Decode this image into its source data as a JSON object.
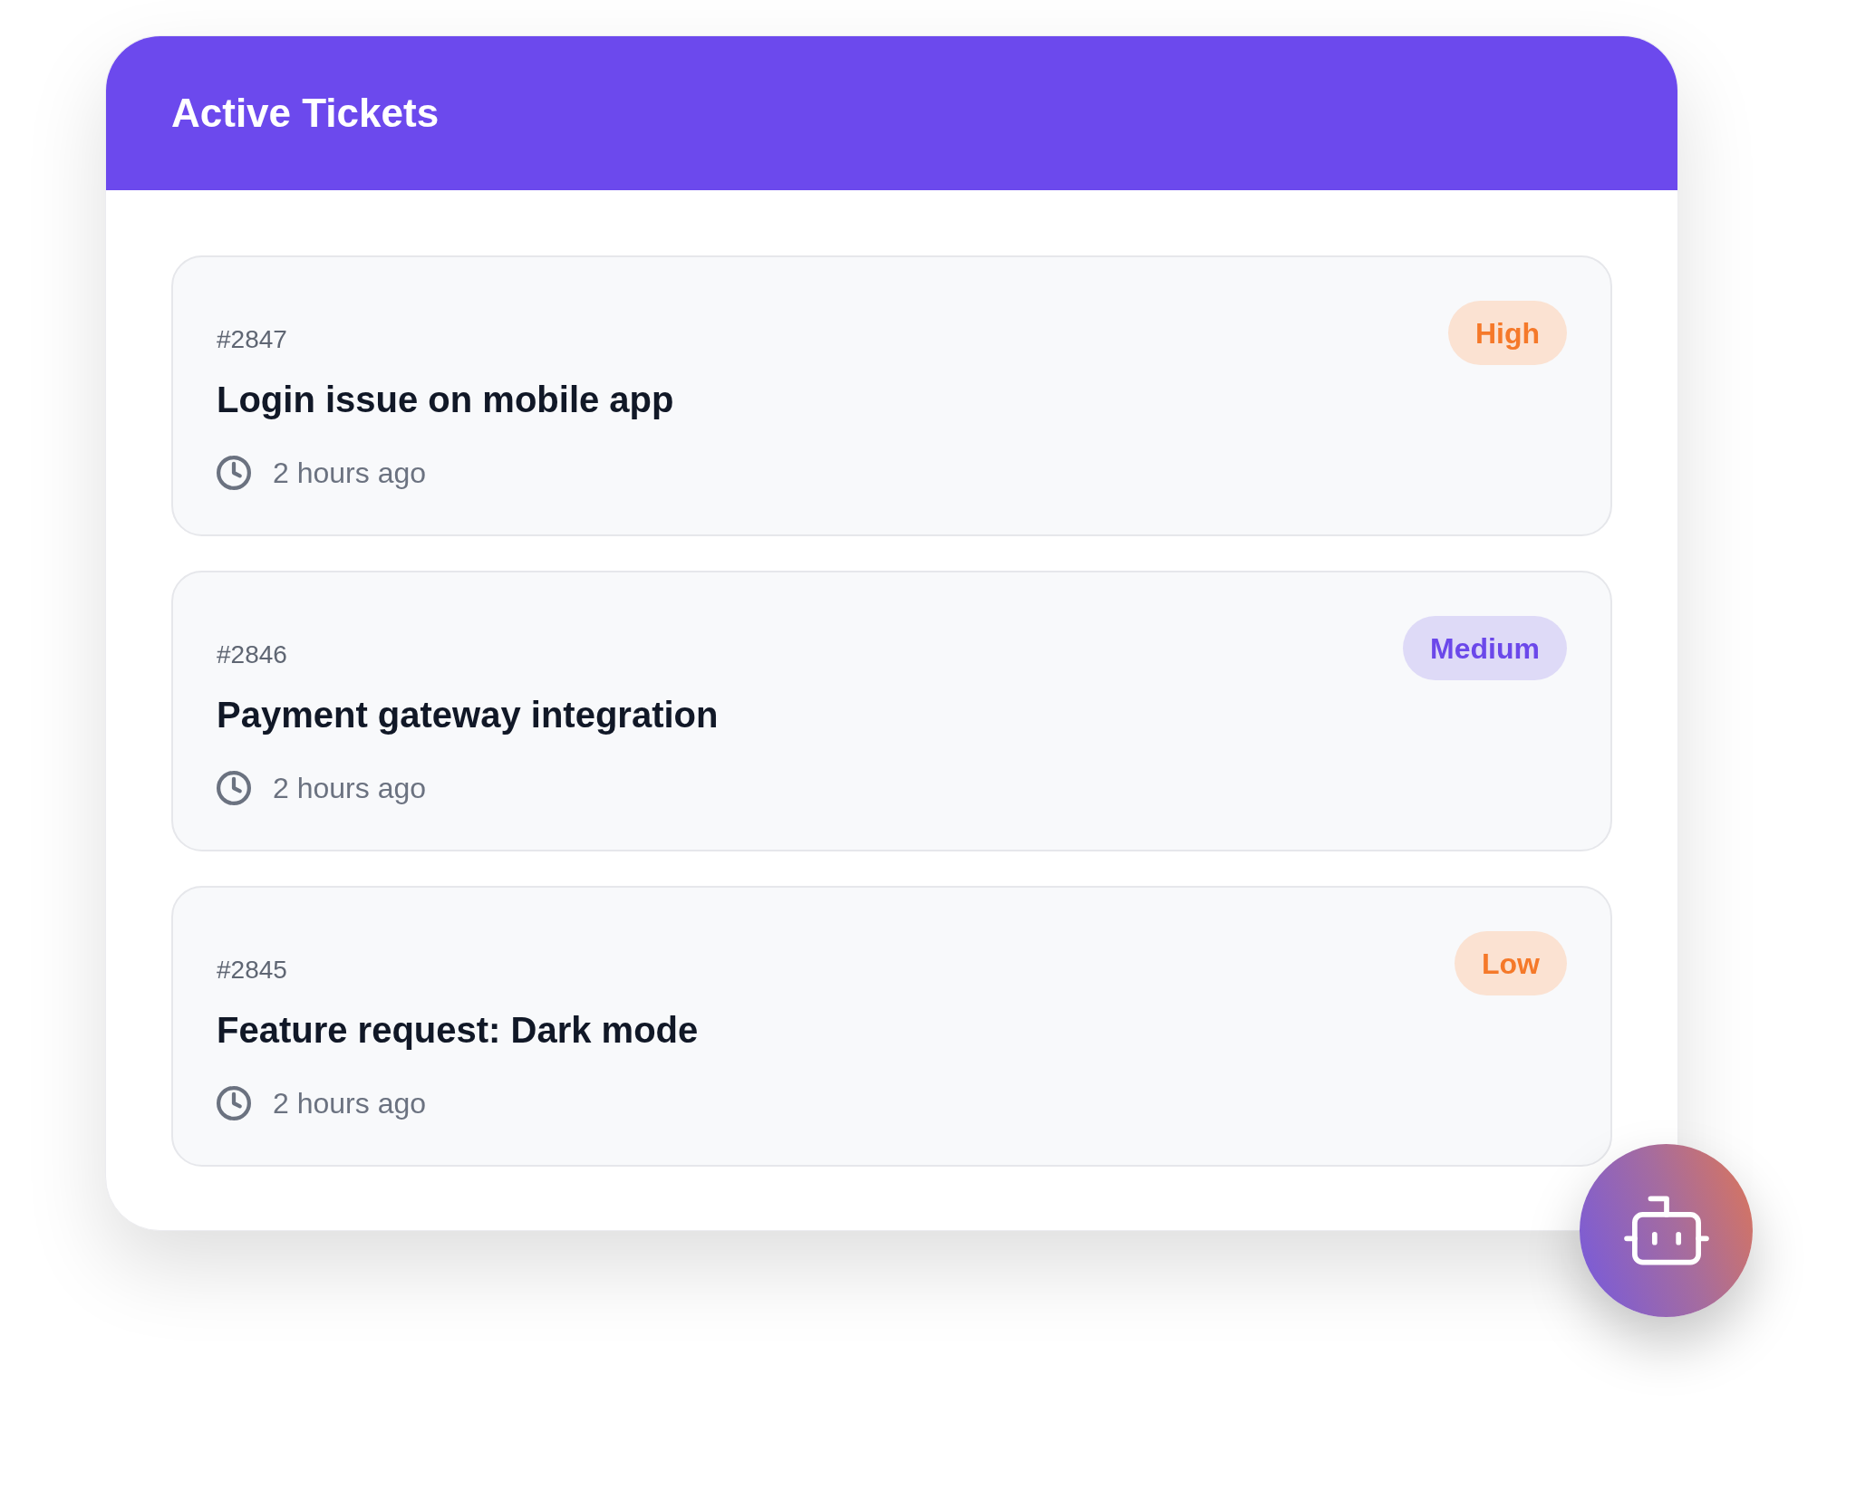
{
  "header": {
    "title": "Active Tickets"
  },
  "tickets": [
    {
      "id": "#2847",
      "title": "Login issue on mobile app",
      "time": "2 hours ago",
      "priority": {
        "label": "High",
        "kind": "high"
      }
    },
    {
      "id": "#2846",
      "title": "Payment gateway integration",
      "time": "2 hours ago",
      "priority": {
        "label": "Medium",
        "kind": "medium"
      }
    },
    {
      "id": "#2845",
      "title": "Feature request: Dark mode",
      "time": "2 hours ago",
      "priority": {
        "label": "Low",
        "kind": "low"
      }
    }
  ]
}
